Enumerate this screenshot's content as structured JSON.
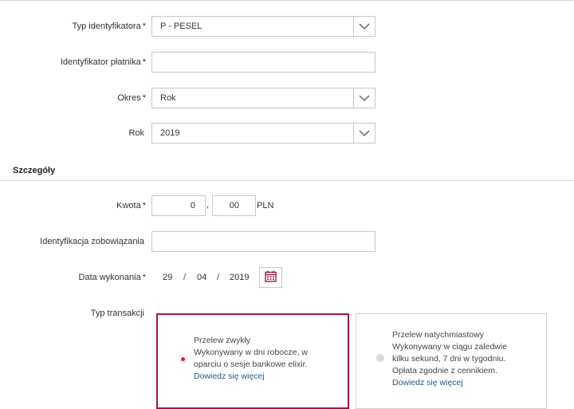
{
  "form": {
    "id_type": {
      "label": "Typ identyfikatora",
      "required": "*",
      "value": "P - PESEL"
    },
    "payer_id": {
      "label": "Identyfikator płatnika",
      "required": "*",
      "value": ""
    },
    "period": {
      "label": "Okres",
      "required": "*",
      "value": "Rok"
    },
    "year": {
      "label": "Rok",
      "value": "2019"
    }
  },
  "details": {
    "section_title": "Szczegóły",
    "amount": {
      "label": "Kwota",
      "required": "*",
      "whole": "0",
      "separator": ",",
      "cents": "00",
      "currency": "PLN"
    },
    "obligation": {
      "label": "Identyfikacja zobowiązania",
      "value": ""
    },
    "date": {
      "label": "Data wykonania",
      "required": "*",
      "day": "29",
      "month": "04",
      "year": "2019",
      "sep": "/"
    },
    "transaction_type": {
      "label": "Typ transakcji",
      "options": [
        {
          "title": "Przelew zwykły",
          "line1": "Wykonywany w dni robocze, w",
          "line2": "oparciu o sesje bankowe elixir.",
          "link": "Dowiedz się więcej",
          "selected": true
        },
        {
          "title": "Przelew natychmiastowy",
          "line1": "Wykonywany w ciągu zaledwie",
          "line2": "kilku sekund, 7 dni w tygodniu.",
          "line3": "Opłata zgodnie z cennikiem.",
          "link": "Dowiedz się więcej",
          "selected": false
        }
      ]
    }
  },
  "colors": {
    "accent": "#a3164a",
    "radio_selected": "#c0245a",
    "radio_disabled": "#d8d8d8",
    "link": "#1f5a8c"
  },
  "icons": {
    "dropdown": "chevron-down-icon",
    "calendar": "calendar-icon"
  }
}
